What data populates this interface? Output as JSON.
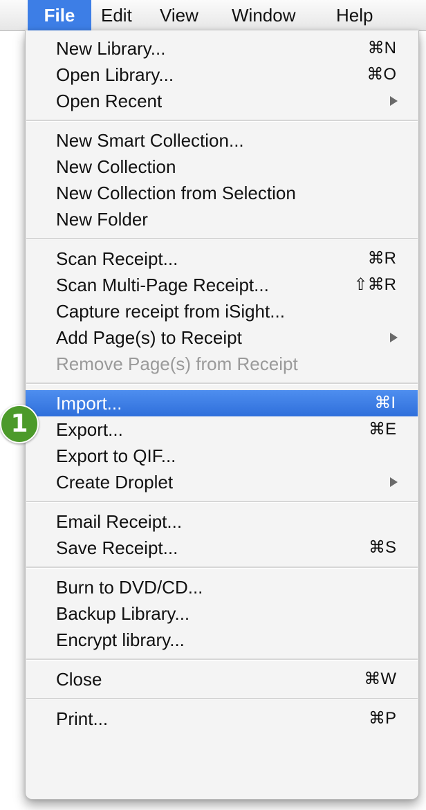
{
  "menubar": {
    "items": [
      {
        "label": "File",
        "active": true
      },
      {
        "label": "Edit"
      },
      {
        "label": "View"
      },
      {
        "label": "Window"
      },
      {
        "label": "Help"
      }
    ]
  },
  "menu": {
    "groups": [
      [
        {
          "label": "New Library...",
          "shortcut": "⌘N"
        },
        {
          "label": "Open Library...",
          "shortcut": "⌘O"
        },
        {
          "label": "Open Recent",
          "submenu": true
        }
      ],
      [
        {
          "label": "New Smart Collection..."
        },
        {
          "label": "New Collection"
        },
        {
          "label": "New Collection from Selection"
        },
        {
          "label": "New Folder"
        }
      ],
      [
        {
          "label": "Scan Receipt...",
          "shortcut": "⌘R"
        },
        {
          "label": "Scan Multi-Page Receipt...",
          "shortcut": "⇧⌘R"
        },
        {
          "label": "Capture receipt from iSight..."
        },
        {
          "label": "Add Page(s) to Receipt",
          "submenu": true
        },
        {
          "label": "Remove Page(s) from Receipt",
          "disabled": true
        }
      ],
      [
        {
          "label": "Import...",
          "shortcut": "⌘I",
          "highlighted": true
        },
        {
          "label": "Export...",
          "shortcut": "⌘E"
        },
        {
          "label": "Export to QIF..."
        },
        {
          "label": "Create Droplet",
          "submenu": true
        }
      ],
      [
        {
          "label": "Email Receipt..."
        },
        {
          "label": "Save Receipt...",
          "shortcut": "⌘S"
        }
      ],
      [
        {
          "label": "Burn to DVD/CD..."
        },
        {
          "label": "Backup Library..."
        },
        {
          "label": "Encrypt library..."
        }
      ],
      [
        {
          "label": "Close",
          "shortcut": "⌘W"
        }
      ],
      [
        {
          "label": "Print...",
          "shortcut": "⌘P"
        }
      ]
    ]
  },
  "callout": {
    "label": "1",
    "color": "#4c9a2a"
  },
  "colors": {
    "highlight": "#3d7ee6",
    "disabled_text": "#9a9a9a",
    "menu_background": "#f4f4f4"
  }
}
